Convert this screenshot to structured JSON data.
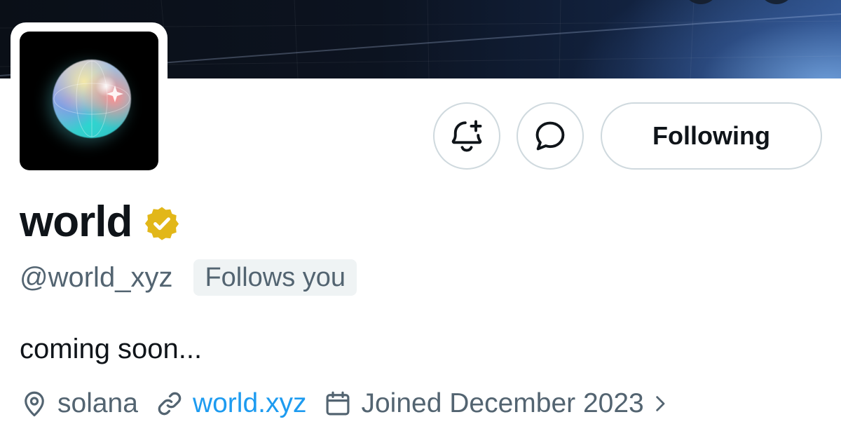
{
  "profile": {
    "display_name": "world",
    "handle": "@world_xyz",
    "follows_you": "Follows you",
    "bio": "coming soon...",
    "location": "solana",
    "website": "world.xyz",
    "joined": "Joined December 2023",
    "verified_badge_color": "#e2b719"
  },
  "actions": {
    "notify_icon": "bell-plus-icon",
    "message_icon": "message-bubble-icon",
    "following_label": "Following"
  },
  "icons": {
    "location": "location-pin-icon",
    "link": "link-icon",
    "calendar": "calendar-icon",
    "more": "chevron-right-icon"
  },
  "colors": {
    "text_primary": "#0f1419",
    "text_secondary": "#536471",
    "link": "#1d9bf0",
    "border": "#cfd9de",
    "badge_bg": "#eff3f4"
  }
}
